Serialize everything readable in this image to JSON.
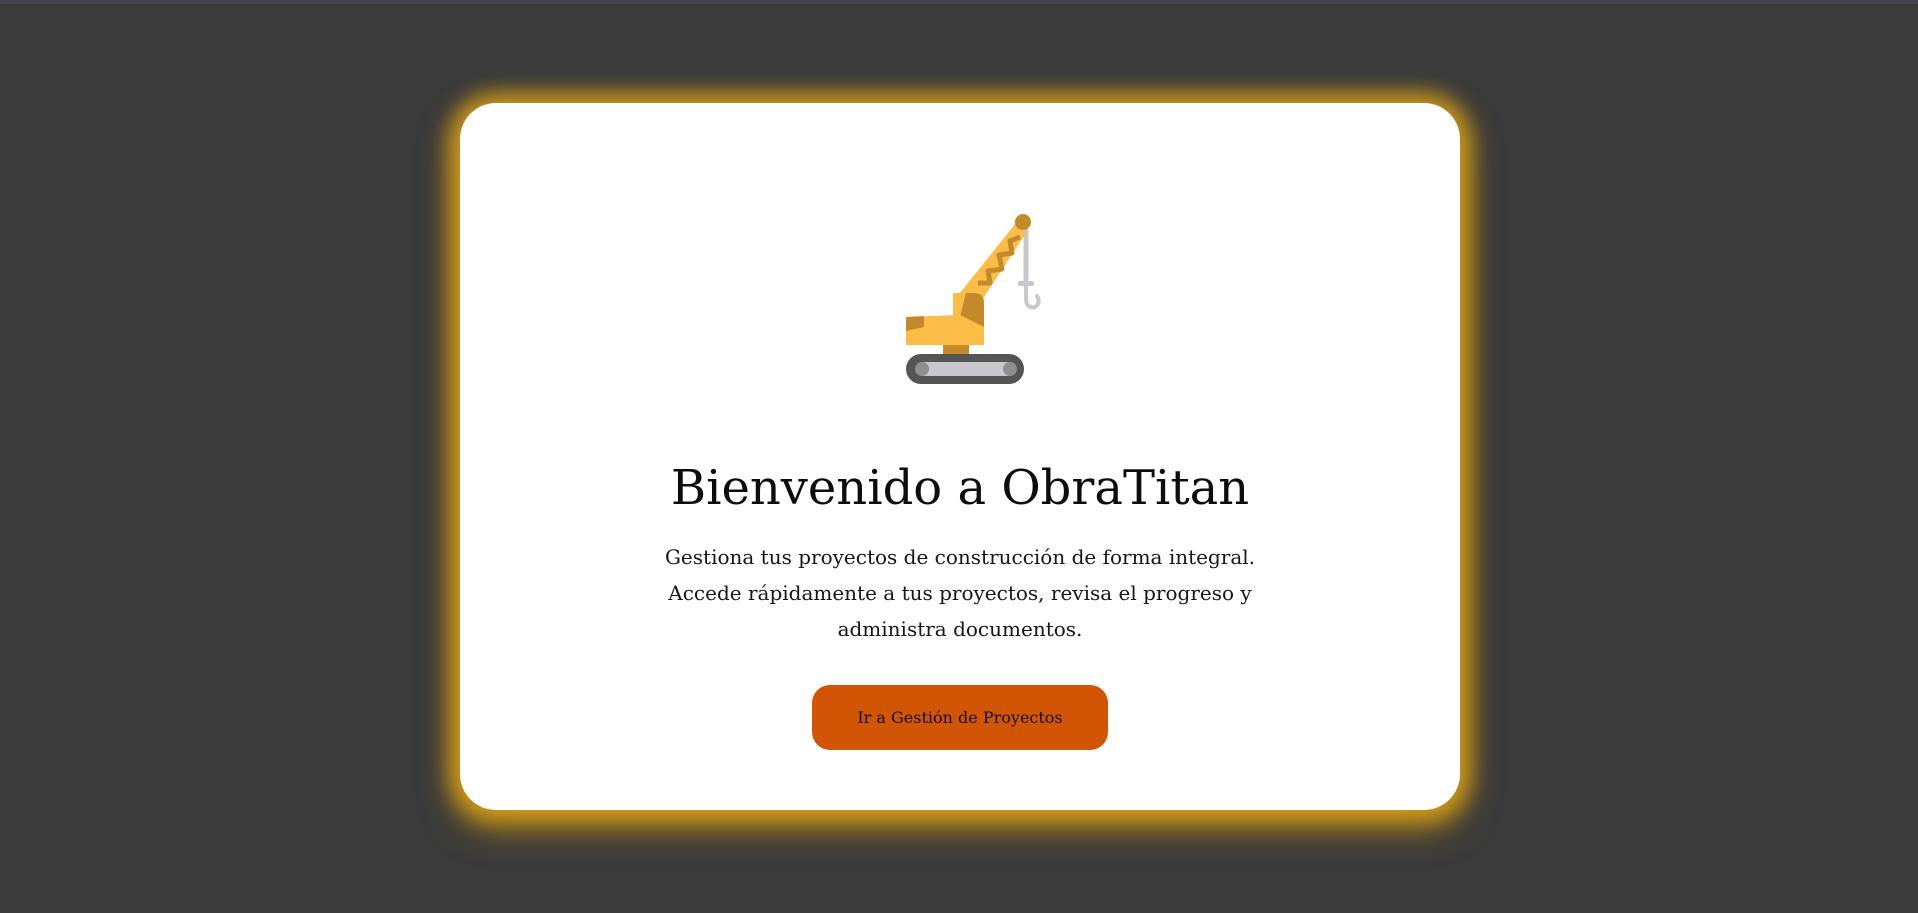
{
  "welcome": {
    "logo_icon": "crane-icon",
    "title": "Bienvenido a ObraTitan",
    "description_line1": "Gestiona tus proyectos de construcción de forma integral.",
    "description_line2": "Accede rápidamente a tus proyectos, revisa el progreso y administra documentos.",
    "cta_label": "Ir a Gestión de Proyectos"
  },
  "colors": {
    "background": "#3b3b3b",
    "card": "#ffffff",
    "card_glow": "#e8aa16",
    "button": "#d15505",
    "crane_body": "#fbbd45",
    "crane_shade": "#c28a2a",
    "track": "#555555"
  }
}
